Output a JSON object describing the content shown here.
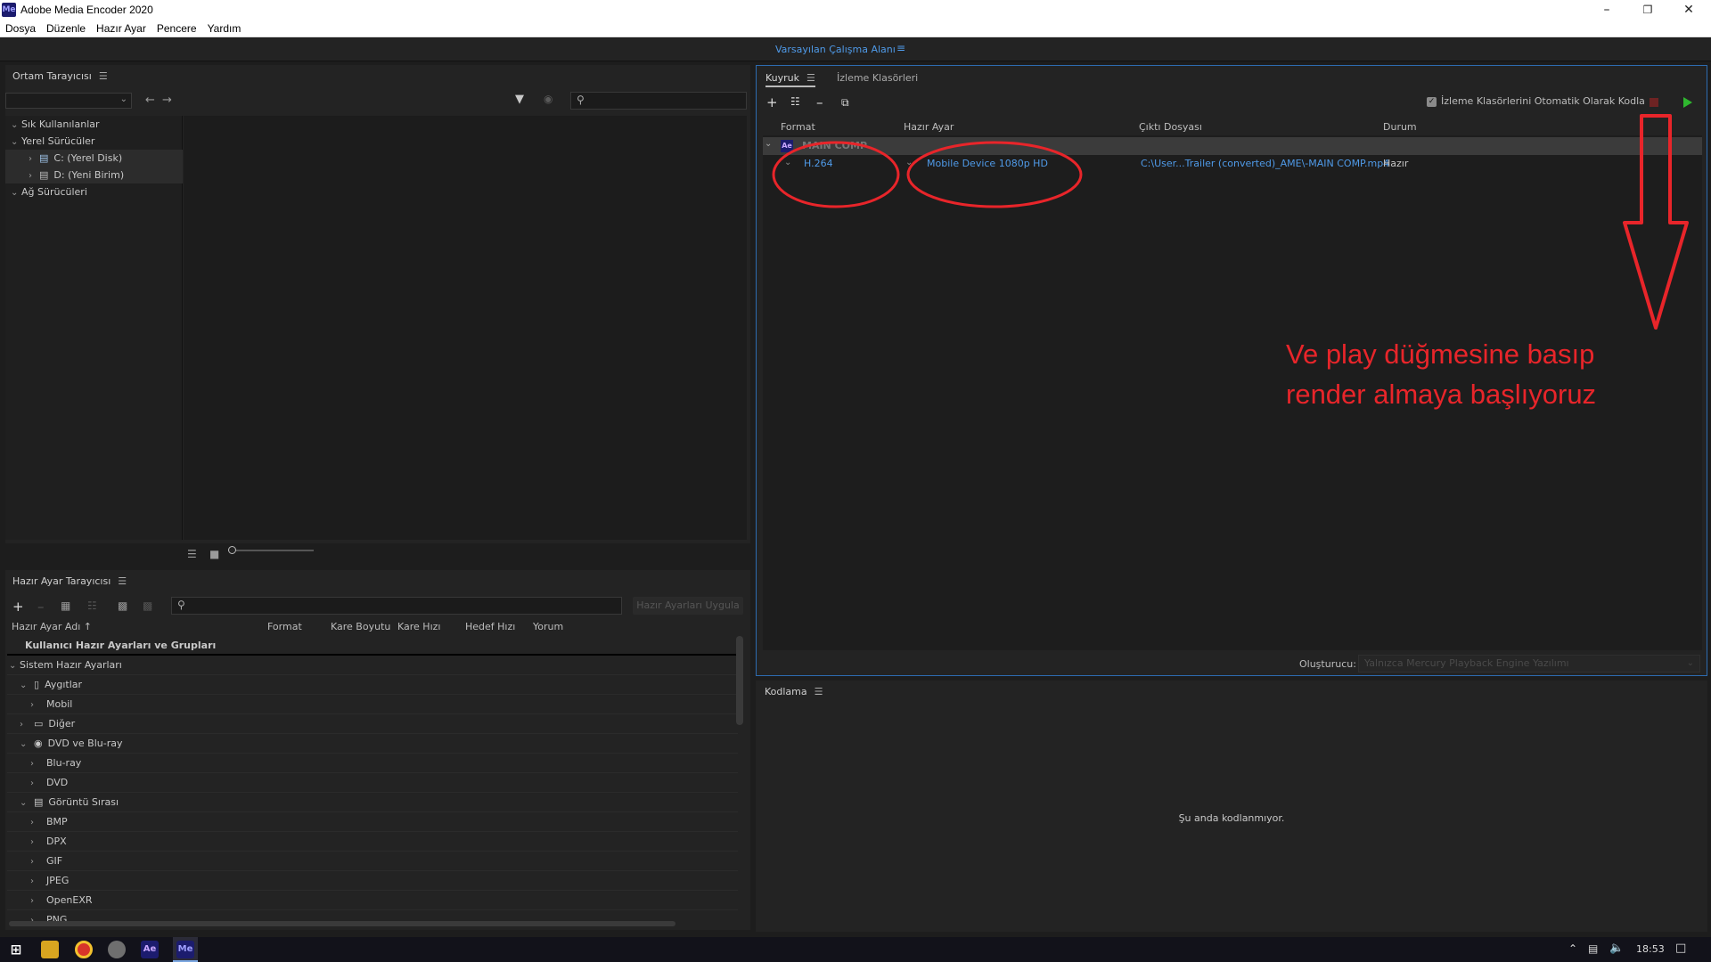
{
  "window": {
    "title": "Adobe Media Encoder 2020",
    "app_icon": "Me",
    "controls": [
      "minimize-icon",
      "restore-icon",
      "close-icon"
    ]
  },
  "menu": [
    "Dosya",
    "Düzenle",
    "Hazır Ayar",
    "Pencere",
    "Yardım"
  ],
  "workspace": {
    "label": "Varsayılan Çalışma Alanı",
    "menu_glyph": "≡"
  },
  "media_browser": {
    "title": "Ortam Tarayıcısı",
    "tree": [
      {
        "label": "Sık Kullanılanlar",
        "level": 0
      },
      {
        "label": "Yerel Sürücüler",
        "level": 0
      },
      {
        "label": "C: (Yerel Disk)",
        "level": 1
      },
      {
        "label": "D: (Yeni Birim)",
        "level": 1
      },
      {
        "label": "Ağ Sürücüleri",
        "level": 0
      }
    ]
  },
  "preset_browser": {
    "title": "Hazır Ayar Tarayıcısı",
    "apply_button": "Hazır Ayarları Uygula",
    "columns": [
      "Hazır Ayar Adı",
      "Format",
      "Kare Boyutu",
      "Kare Hızı",
      "Hedef Hızı",
      "Yorum"
    ],
    "rows": [
      {
        "label": "Kullanıcı Hazır Ayarları ve Grupları",
        "level": 0,
        "bold": true
      },
      {
        "label": "Sistem Hazır Ayarları",
        "level": 0,
        "expanded": true
      },
      {
        "label": "Aygıtlar",
        "level": 1,
        "expanded": true,
        "icon": "phone-icon"
      },
      {
        "label": "Mobil",
        "level": 2
      },
      {
        "label": "Diğer",
        "level": 1,
        "icon": "monitor-icon"
      },
      {
        "label": "DVD ve Blu-ray",
        "level": 1,
        "expanded": true,
        "icon": "disc-icon"
      },
      {
        "label": "Blu-ray",
        "level": 2
      },
      {
        "label": "DVD",
        "level": 2
      },
      {
        "label": "Görüntü Sırası",
        "level": 1,
        "expanded": true,
        "icon": "image-sequence-icon"
      },
      {
        "label": "BMP",
        "level": 2
      },
      {
        "label": "DPX",
        "level": 2
      },
      {
        "label": "GIF",
        "level": 2
      },
      {
        "label": "JPEG",
        "level": 2
      },
      {
        "label": "OpenEXR",
        "level": 2
      },
      {
        "label": "PNG",
        "level": 2
      }
    ]
  },
  "queue": {
    "tabs": [
      "Kuyruk",
      "İzleme Klasörleri"
    ],
    "auto_encode_label": "İzleme Klasörlerini Otomatik Olarak Kodla",
    "auto_encode_checked": true,
    "columns": [
      "Format",
      "Hazır Ayar",
      "Çıktı Dosyası",
      "Durum"
    ],
    "group": {
      "icon": "Ae",
      "name": "MAIN COMP"
    },
    "item": {
      "format": "H.264",
      "preset": "Mobile Device 1080p HD",
      "output": "C:\\User...Trailer (converted)_AME\\-MAIN COMP.mp4",
      "status": "Hazır"
    },
    "renderer_label": "Oluşturucu:",
    "renderer_value": "Yalnızca Mercury Playback Engine Yazılımı"
  },
  "annotation": {
    "text_line1": "Ve play düğmesine basıp",
    "text_line2": "render almaya başlıyoruz",
    "color": "#e8252a"
  },
  "encoding": {
    "title": "Kodlama",
    "empty_message": "Şu anda kodlanmıyor."
  },
  "taskbar": {
    "apps": [
      "windows-start-icon",
      "file-explorer-icon",
      "chrome-icon",
      "app-icon",
      "after-effects-icon",
      "media-encoder-icon"
    ],
    "ae_label": "Ae",
    "me_label": "Me",
    "time": "18:53"
  },
  "colors": {
    "accent": "#4f9ae8",
    "panel": "#232323",
    "play": "#2fb72f",
    "annotation": "#e8252a"
  }
}
